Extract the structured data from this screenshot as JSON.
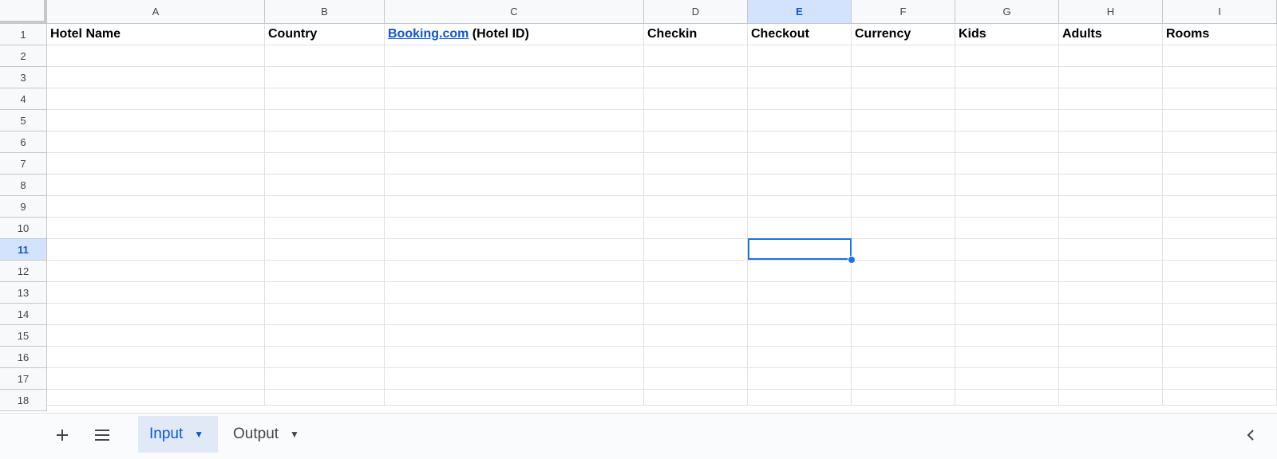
{
  "sheet": {
    "columns": [
      "A",
      "B",
      "C",
      "D",
      "E",
      "F",
      "G",
      "H",
      "I"
    ],
    "selected_column": "E",
    "rows": [
      "1",
      "2",
      "3",
      "4",
      "5",
      "6",
      "7",
      "8",
      "9",
      "10",
      "11",
      "12",
      "13",
      "14",
      "15",
      "16",
      "17",
      "18"
    ],
    "selected_row": "11",
    "headers": {
      "A": "Hotel Name",
      "B": "Country",
      "C_link": "Booking.com",
      "C_rest": " (Hotel ID)",
      "D": "Checkin",
      "E": "Checkout",
      "F": "Currency",
      "G": "Kids",
      "H": "Adults",
      "I": "Rooms"
    },
    "active_cell": "E11"
  },
  "tabs": {
    "add_icon": "plus-icon",
    "menu_icon": "menu-icon",
    "items": [
      {
        "label": "Input",
        "active": true
      },
      {
        "label": "Output",
        "active": false
      }
    ],
    "collapse_icon": "chevron-left-icon"
  },
  "colors": {
    "accent": "#1a73e8",
    "selected_header_bg": "#d3e3fd",
    "link": "#1155cc"
  }
}
